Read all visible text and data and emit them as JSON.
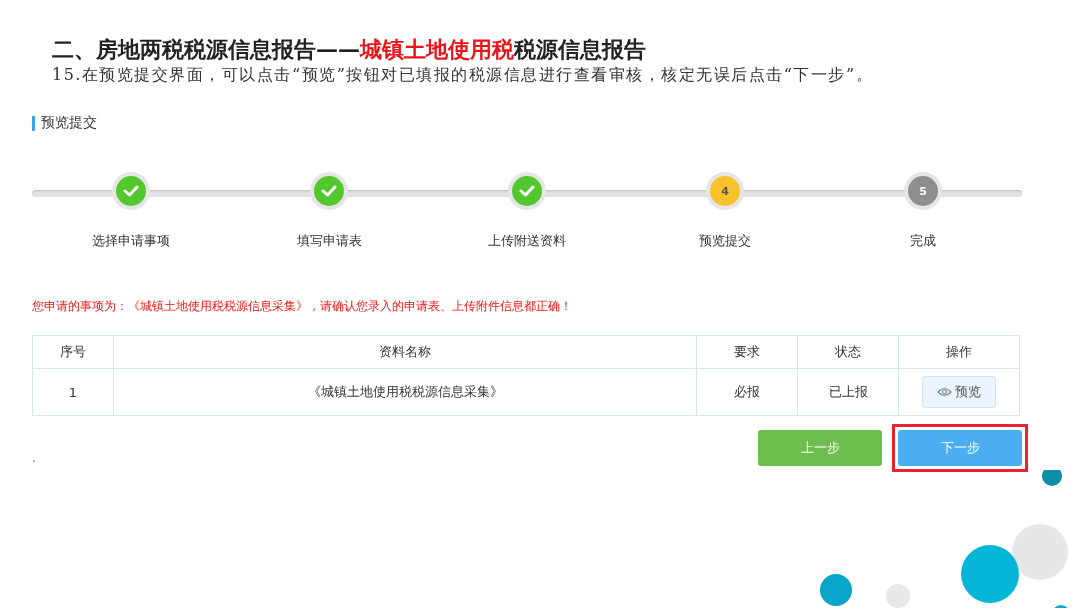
{
  "heading": {
    "prefix": "二、房地两税税源信息报告——",
    "highlight": "城镇土地使用税",
    "suffix": "税源信息报告"
  },
  "instruction": "15.在预览提交界面，可以点击“预览”按钮对已填报的税源信息进行查看审核，核定无误后点击“下一步”。",
  "section_title": "预览提交",
  "steps": [
    {
      "label": "选择申请事项",
      "kind": "done"
    },
    {
      "label": "填写申请表",
      "kind": "done"
    },
    {
      "label": "上传附送资料",
      "kind": "done"
    },
    {
      "label": "预览提交",
      "kind": "current",
      "number": "4"
    },
    {
      "label": "完成",
      "kind": "pending",
      "number": "5"
    }
  ],
  "notice": "您申请的事项为：《城镇土地使用税税源信息采集》，请确认您录入的申请表、上传附件信息都正确！",
  "table": {
    "columns": [
      "序号",
      "资料名称",
      "要求",
      "状态",
      "操作"
    ],
    "rows": [
      {
        "index": "1",
        "name": "《城镇土地使用税税源信息采集》",
        "requirement": "必报",
        "status": "已上报",
        "action": "预览"
      }
    ]
  },
  "stray_mark": ".",
  "buttons": [
    {
      "label": "上一步",
      "kind": "back",
      "highlighted": false
    },
    {
      "label": "下一步",
      "kind": "next",
      "highlighted": true
    }
  ]
}
